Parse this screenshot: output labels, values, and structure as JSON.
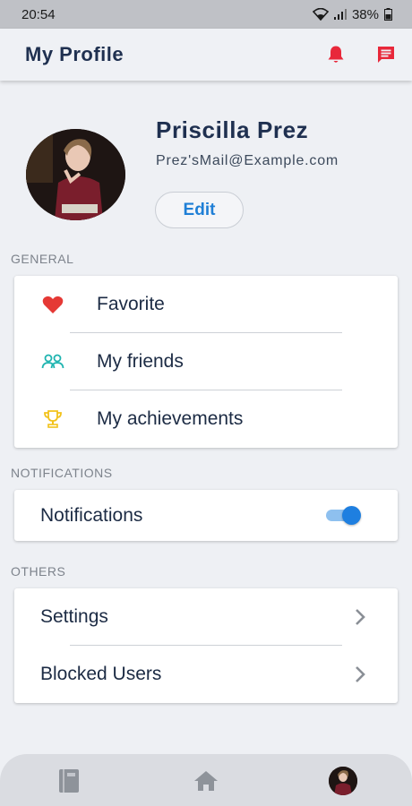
{
  "status_bar": {
    "time": "20:54",
    "battery": "38%"
  },
  "app_bar": {
    "title": "My Profile",
    "notification_icon": "bell-icon",
    "message_icon": "chat-icon",
    "accent": "#e8283a"
  },
  "profile": {
    "name": "Priscilla Prez",
    "email": "Prez'sMail@Example.com",
    "edit_label": "Edit"
  },
  "general": {
    "section_label": "GENERAL",
    "items": [
      {
        "label": "Favorite",
        "icon": "heart-icon",
        "color": "#e53935"
      },
      {
        "label": "My friends",
        "icon": "users-icon",
        "color": "#1fb4b0"
      },
      {
        "label": "My achievements",
        "icon": "trophy-icon",
        "color": "#f2c21b"
      }
    ]
  },
  "notifications": {
    "section_label": "NOTIFICATIONS",
    "label": "Notifications",
    "enabled": true
  },
  "others": {
    "section_label": "OTHERS",
    "items": [
      {
        "label": "Settings"
      },
      {
        "label": "Blocked Users"
      }
    ]
  },
  "bottom_nav": {
    "items": [
      {
        "icon": "book-icon"
      },
      {
        "icon": "home-icon"
      },
      {
        "icon": "profile-avatar"
      }
    ]
  }
}
